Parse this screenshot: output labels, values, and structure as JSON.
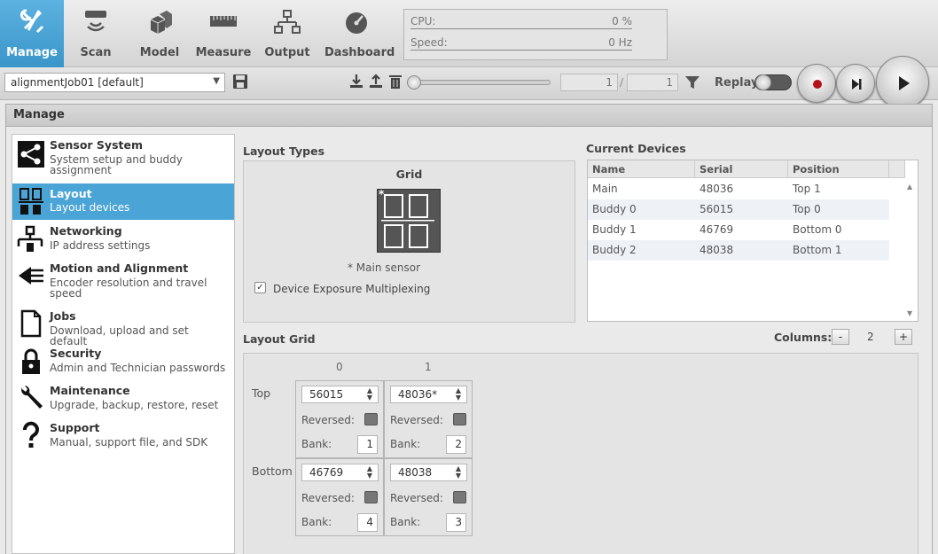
{
  "tabs": [
    {
      "label": "Manage",
      "icon": "tools-icon",
      "active": true
    },
    {
      "label": "Scan",
      "icon": "scan-icon"
    },
    {
      "label": "Model",
      "icon": "cubes-icon"
    },
    {
      "label": "Measure",
      "icon": "ruler-icon"
    },
    {
      "label": "Output",
      "icon": "network-icon"
    },
    {
      "label": "Dashboard",
      "icon": "gauge-icon"
    }
  ],
  "status": {
    "cpu_label": "CPU:",
    "cpu_value": "0 %",
    "speed_label": "Speed:",
    "speed_value": "0 Hz"
  },
  "job": {
    "selected": "alignmentJob01 [default]"
  },
  "playback": {
    "frame_current": "1",
    "separator": "/",
    "frame_total": "1",
    "replay_label": "Replay",
    "replay_on": false,
    "slider_position": 0
  },
  "panel": {
    "title": "Manage"
  },
  "sidebar": {
    "selected_color": "#4ba4d6",
    "items": [
      {
        "title": "Sensor System",
        "desc": "System setup and buddy assignment",
        "icon": "share-icon"
      },
      {
        "title": "Layout",
        "desc": "Layout devices",
        "icon": "layout-icon",
        "selected": true
      },
      {
        "title": "Networking",
        "desc": "IP address settings",
        "icon": "network-icon"
      },
      {
        "title": "Motion and Alignment",
        "desc": "Encoder resolution and travel speed",
        "icon": "encoder-icon"
      },
      {
        "title": "Jobs",
        "desc": "Download, upload and set default",
        "icon": "document-icon"
      },
      {
        "title": "Security",
        "desc": "Admin and Technician passwords",
        "icon": "lock-icon"
      },
      {
        "title": "Maintenance",
        "desc": "Upgrade, backup, restore, reset",
        "icon": "wrench-icon"
      },
      {
        "title": "Support",
        "desc": "Manual, support file, and SDK",
        "icon": "question-icon"
      }
    ]
  },
  "layout_types": {
    "title": "Layout Types",
    "grid_label": "Grid",
    "main_sensor_note": "* Main sensor",
    "grid_star": "*",
    "exposure_label": "Device Exposure Multiplexing",
    "exposure_checked": true
  },
  "current_devices": {
    "title": "Current Devices",
    "columns": [
      "Name",
      "Serial",
      "Position"
    ],
    "rows": [
      {
        "name": "Main",
        "serial": "48036",
        "position": "Top 1"
      },
      {
        "name": "Buddy 0",
        "serial": "56015",
        "position": "Top 0"
      },
      {
        "name": "Buddy 1",
        "serial": "46769",
        "position": "Bottom 0"
      },
      {
        "name": "Buddy 2",
        "serial": "48038",
        "position": "Bottom 1"
      }
    ]
  },
  "layout_grid": {
    "title": "Layout Grid",
    "columns_label": "Columns:",
    "columns_value": "2",
    "minus": "-",
    "plus": "+",
    "col_headers": [
      "0",
      "1"
    ],
    "row_headers": [
      "Top",
      "Bottom"
    ],
    "reversed_label": "Reversed:",
    "bank_label": "Bank:",
    "cells": [
      {
        "serial": "56015",
        "reversed": false,
        "bank": "1"
      },
      {
        "serial": "48036*",
        "reversed": false,
        "bank": "2"
      },
      {
        "serial": "46769",
        "reversed": false,
        "bank": "4"
      },
      {
        "serial": "48038",
        "reversed": false,
        "bank": "3"
      }
    ]
  }
}
